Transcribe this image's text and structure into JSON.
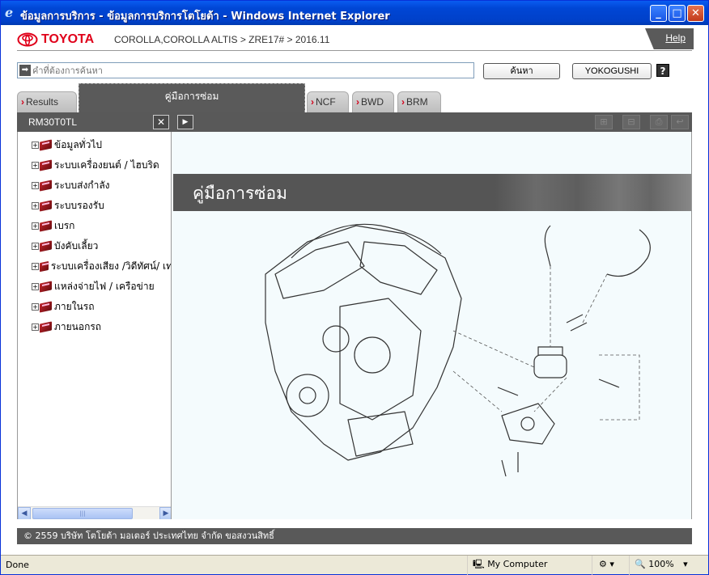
{
  "window": {
    "title": "ข้อมูลการบริการ - ข้อมูลการบริการโตโยต้า - Windows Internet Explorer",
    "minimize": "_",
    "maximize": "□",
    "close": "✕"
  },
  "header": {
    "brand": "TOYOTA",
    "breadcrumb": "COROLLA,COROLLA ALTIS > ZRE17# > 2016.11",
    "help": "Help"
  },
  "search": {
    "placeholder": "คำที่ต้องการค้นหา",
    "search_button": "ค้นหา",
    "yokogushi_button": "YOKOGUSHI",
    "question": "?"
  },
  "tabs": [
    {
      "label": "Results"
    },
    {
      "label": "คู่มือการซ่อม",
      "active": true
    },
    {
      "label": "NCF"
    },
    {
      "label": "BWD"
    },
    {
      "label": "BRM"
    }
  ],
  "toolbar": {
    "doc_code": "RM30T0TL",
    "close": "✕",
    "expand": "▶"
  },
  "tree": [
    {
      "label": "ข้อมูลทั่วไป"
    },
    {
      "label": "ระบบเครื่องยนต์ / ไฮบริด"
    },
    {
      "label": "ระบบส่งกำลัง"
    },
    {
      "label": "ระบบรองรับ"
    },
    {
      "label": "เบรก"
    },
    {
      "label": "บังคับเลี้ยว"
    },
    {
      "label": "ระบบเครื่องเสียง /วิดีทัศน์/ เท"
    },
    {
      "label": "แหล่งจ่ายไฟ / เครือข่าย"
    },
    {
      "label": "ภายในรถ"
    },
    {
      "label": "ภายนอกรถ"
    }
  ],
  "main": {
    "banner_title": "คู่มือการซ่อม"
  },
  "footer": {
    "copyright": "© 2559 บริษัท โตโยต้า มอเตอร์ ประเทศไทย จำกัด ขอสงวนสิทธิ์"
  },
  "status": {
    "text": "Done",
    "zone": "My Computer",
    "zoom": "100%"
  },
  "colors": {
    "brand_red": "#e0001a",
    "dark_bar": "#595959",
    "xp_blue": "#0046d5"
  }
}
